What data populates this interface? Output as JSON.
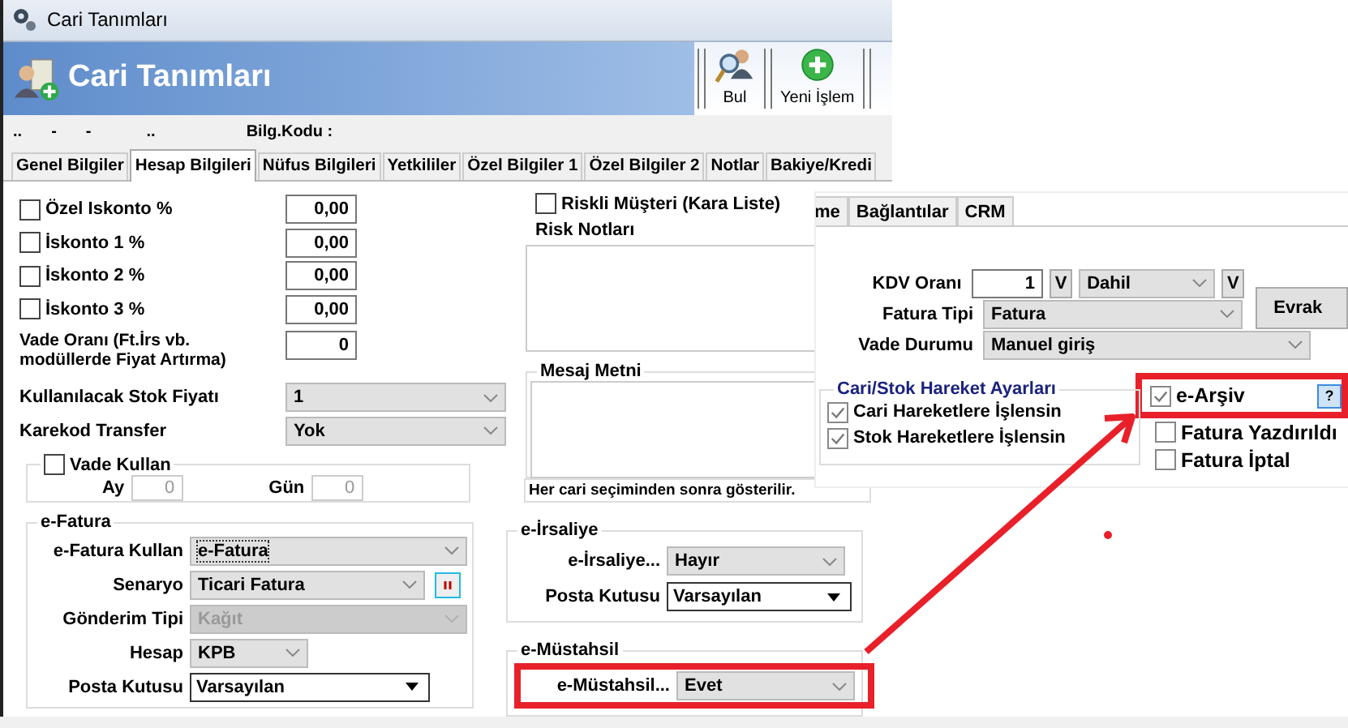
{
  "window": {
    "title": "Cari Tanımları"
  },
  "header": {
    "title": "Cari Tanımları"
  },
  "toolbar": [
    {
      "label": "Bul",
      "kind": "search"
    },
    {
      "label": "Yeni İşlem",
      "kind": "add"
    }
  ],
  "info_bar": {
    "marks": [
      "..",
      "-",
      "-",
      ".."
    ],
    "label": "Bilg.Kodu :"
  },
  "tabs": [
    {
      "label": "Genel Bilgiler",
      "selected": false
    },
    {
      "label": "Hesap Bilgileri",
      "selected": true
    },
    {
      "label": "Nüfus Bilgileri",
      "selected": false
    },
    {
      "label": "Yetkililer",
      "selected": false
    },
    {
      "label": "Özel Bilgiler 1",
      "selected": false
    },
    {
      "label": "Özel Bilgiler 2",
      "selected": false
    },
    {
      "label": "Notlar",
      "selected": false
    },
    {
      "label": "Bakiye/Kredi",
      "selected": false
    }
  ],
  "discounts": [
    {
      "label": "Özel Iskonto %",
      "checked": false,
      "value": "0,00"
    },
    {
      "label": "İskonto 1 %",
      "checked": false,
      "value": "0,00"
    },
    {
      "label": "İskonto 2 %",
      "checked": false,
      "value": "0,00"
    },
    {
      "label": "İskonto 3 %",
      "checked": false,
      "value": "0,00"
    }
  ],
  "vade_orani": {
    "label": "Vade Oranı (Ft.İrs vb. modüllerde Fiyat Artırma)",
    "value": "0"
  },
  "selects": [
    {
      "label": "Kullanılacak Stok Fiyatı",
      "value": "1"
    },
    {
      "label": "Karekod Transfer",
      "value": "Yok"
    }
  ],
  "vade_kullan": {
    "label": "Vade Kullan",
    "checked": false,
    "fields": [
      {
        "label": "Ay",
        "value": "0"
      },
      {
        "label": "Gün",
        "value": "0"
      }
    ]
  },
  "e_fatura": {
    "title": "e-Fatura",
    "rows": [
      {
        "label": "e-Fatura Kullan",
        "value": "e-Fatura",
        "kind": "combo",
        "disabled": false
      },
      {
        "label": "Senaryo",
        "value": "Ticari Fatura",
        "kind": "combo_button",
        "disabled": false
      },
      {
        "label": "Gönderim Tipi",
        "value": "Kağıt",
        "kind": "combo",
        "disabled": true
      },
      {
        "label": "Hesap",
        "value": "KPB",
        "kind": "short",
        "disabled": false
      },
      {
        "label": "Posta Kutusu",
        "value": "Varsayılan",
        "kind": "dropdown",
        "disabled": false
      }
    ]
  },
  "risk": {
    "label": "Riskli Müşteri (Kara Liste)",
    "checked": false,
    "notes_label": "Risk Notları"
  },
  "mesaj": {
    "title": "Mesaj Metni",
    "hint": "Her cari seçiminden sonra gösterilir."
  },
  "e_irsaliye": {
    "title": "e-İrsaliye",
    "rows": [
      {
        "label": "e-İrsaliye...",
        "value": "Hayır",
        "kind": "combo",
        "highlighted": false
      },
      {
        "label": "Posta Kutusu",
        "value": "Varsayılan",
        "kind": "dropdown",
        "highlighted": false
      }
    ]
  },
  "e_mustahsil": {
    "title": "e-Müstahsil",
    "rows": [
      {
        "label": "e-Müstahsil...",
        "value": "Evet",
        "kind": "combo",
        "highlighted": true
      }
    ]
  },
  "inset": {
    "tabs": [
      "me",
      "Bağlantılar",
      "CRM"
    ],
    "kdv": {
      "label": "KDV Oranı",
      "value": "1",
      "button": "V",
      "mode": "Dahil",
      "mode_button": "V"
    },
    "evrak_button": "Evrak",
    "fatura_tipi": {
      "label": "Fatura Tipi",
      "value": "Fatura"
    },
    "vade_durumu": {
      "label": "Vade Durumu",
      "value": "Manuel giriş"
    },
    "hareket": {
      "title": "Cari/Stok Hareket Ayarları",
      "items": [
        {
          "label": "Cari Hareketlere İşlensin",
          "checked": true
        },
        {
          "label": "Stok Hareketlere İşlensin",
          "checked": true
        }
      ]
    },
    "flags": [
      {
        "label": "e-Arşiv",
        "checked": true,
        "highlighted": true
      },
      {
        "label": "Fatura Yazdırıldı",
        "checked": false,
        "highlighted": false
      },
      {
        "label": "Fatura İptal",
        "checked": false,
        "highlighted": false
      }
    ],
    "help_button": "?"
  }
}
